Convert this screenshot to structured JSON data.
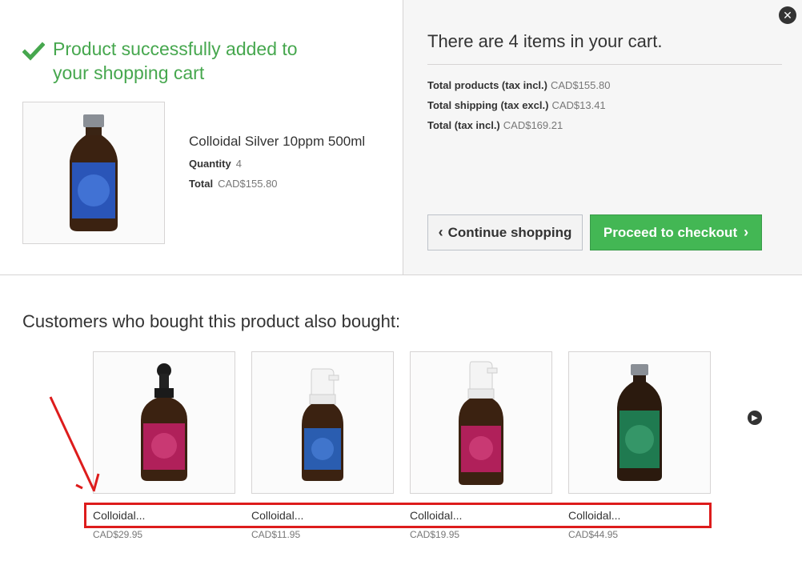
{
  "colors": {
    "accent_green": "#46a74e",
    "checkout_green": "#43b754",
    "annotation_red": "#dd1c1c"
  },
  "success_message": "Product successfully added to your shopping cart",
  "product": {
    "name": "Colloidal Silver 10ppm 500ml",
    "quantity_label": "Quantity",
    "quantity": "4",
    "total_label": "Total",
    "total": "CAD$155.80"
  },
  "cart": {
    "title": "There are 4 items in your cart.",
    "lines": [
      {
        "label": "Total products (tax incl.)",
        "value": "CAD$155.80"
      },
      {
        "label": "Total shipping (tax excl.)",
        "value": "CAD$13.41"
      },
      {
        "label": "Total (tax incl.)",
        "value": "CAD$169.21"
      }
    ],
    "continue_label": "Continue shopping",
    "checkout_label": "Proceed to checkout"
  },
  "cross_sell": {
    "title": "Customers who bought this product also bought:",
    "items": [
      {
        "name": "Colloidal...",
        "price": "CAD$29.95",
        "bottle": "dropper",
        "label_color": "#b0205a"
      },
      {
        "name": "Colloidal...",
        "price": "CAD$11.95",
        "bottle": "spray",
        "label_color": "#2a5db0"
      },
      {
        "name": "Colloidal...",
        "price": "CAD$19.95",
        "bottle": "spray",
        "label_color": "#b0205a"
      },
      {
        "name": "Colloidal...",
        "price": "CAD$44.95",
        "bottle": "cap",
        "label_color": "#1f7a50"
      }
    ]
  },
  "icons": {
    "success": "check-icon",
    "close": "close-icon",
    "prev": "chevron-left-icon",
    "next": "chevron-right-icon",
    "carousel_next": "carousel-next-icon"
  }
}
